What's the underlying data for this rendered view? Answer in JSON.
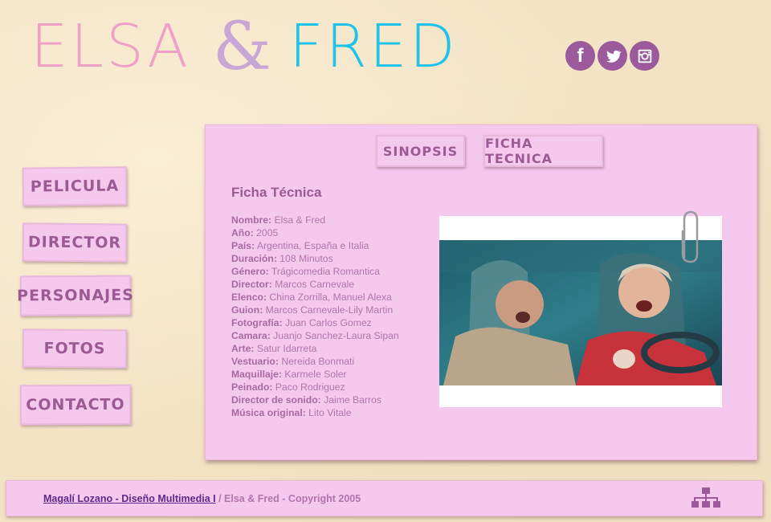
{
  "logo": {
    "part1": "ELSA",
    "amp": "&",
    "part2": "FRED"
  },
  "social": [
    {
      "icon": "facebook-icon",
      "glyph": "f"
    },
    {
      "icon": "twitter-icon"
    },
    {
      "icon": "instagram-icon"
    }
  ],
  "nav": {
    "pelicula": "PELICULA",
    "director": "DIRECTOR",
    "personajes": "PERSONAJES",
    "fotos": "FOTOS",
    "contacto": "CONTACTO"
  },
  "tabs": {
    "sinopsis": "SINOPSIS",
    "ficha": "FICHA TECNICA"
  },
  "ficha": {
    "title": "Ficha Técnica",
    "rows": [
      {
        "label": "Nombre:",
        "value": "Elsa & Fred"
      },
      {
        "label": "Año:",
        "value": "2005"
      },
      {
        "label": "País:",
        "value": "Argentina, España e Italia"
      },
      {
        "label": "Duración:",
        "value": "108 Minutos"
      },
      {
        "label": "Género:",
        "value": "Trágicomedia Romantica"
      },
      {
        "label": "Director:",
        "value": "Marcos Carnevale"
      },
      {
        "label": "Elenco:",
        "value": "China Zorrilla, Manuel Alexa"
      },
      {
        "label": "Guion:",
        "value": "Marcos Carnevale-Lily Martin"
      },
      {
        "label": "Fotografía:",
        "value": "Juan Carlos Gomez"
      },
      {
        "label": "Camara:",
        "value": "Juanjo Sanchez-Laura Sipan"
      },
      {
        "label": "Arte:",
        "value": "Satur Idarreta"
      },
      {
        "label": "Vestuario:",
        "value": "Nereida Bonmati"
      },
      {
        "label": "Maquillaje:",
        "value": "Karmele Soler"
      },
      {
        "label": "Peinado:",
        "value": "Paco Rodriguez"
      },
      {
        "label": "Director de sonido:",
        "value": "Jaime Barros"
      },
      {
        "label": "Música original:",
        "value": "Lito Vitale"
      }
    ]
  },
  "footer": {
    "link": "Magalí Lozano - Diseño Multimedia I",
    "rest": " / Elsa & Fred - Copyright 2005"
  },
  "colors": {
    "background": "#f3e3c4",
    "panel": "#f5c8ee",
    "accent_text": "#9b5a94",
    "social": "#9a5a9c",
    "elsa": "#f0a0c8",
    "fred": "#1ec3ea"
  }
}
